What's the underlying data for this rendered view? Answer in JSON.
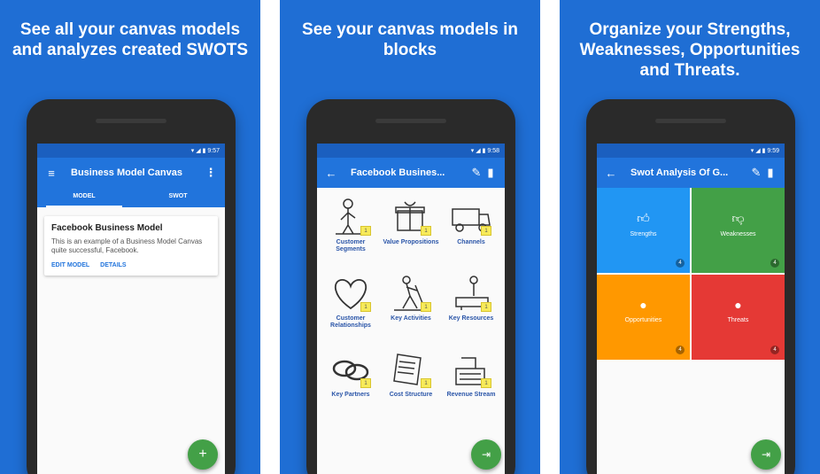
{
  "panels": [
    {
      "headline": "See all your canvas models and analyzes created SWOTS",
      "status_time": "9:57",
      "appbar_title": "Business Model Canvas",
      "tabs": [
        "MODEL",
        "SWOT"
      ],
      "card": {
        "title": "Facebook Business Model",
        "description": "This is an example of a Business Model Canvas quite successful, Facebook.",
        "actions": [
          "EDIT MODEL",
          "DETAILS"
        ]
      },
      "fab_icon": "+"
    },
    {
      "headline": "See your canvas models in blocks",
      "status_time": "9:58",
      "appbar_title": "Facebook Busines...",
      "blocks": [
        {
          "label": "Customer Segments",
          "count": "1"
        },
        {
          "label": "Value Propositions",
          "count": "1"
        },
        {
          "label": "Channels",
          "count": "1"
        },
        {
          "label": "Customer Relationships",
          "count": "1"
        },
        {
          "label": "Key Activities",
          "count": "1"
        },
        {
          "label": "Key Resources",
          "count": "1"
        },
        {
          "label": "Key Partners",
          "count": "1"
        },
        {
          "label": "Cost Structure",
          "count": "1"
        },
        {
          "label": "Revenue Stream",
          "count": "1"
        }
      ]
    },
    {
      "headline": "Organize your Strengths, Weaknesses, Opportunities and Threats.",
      "status_time": "9:59",
      "appbar_title": "Swot Analysis Of G...",
      "swot": [
        {
          "label": "Strengths",
          "color": "#2196f3",
          "icon": "thumbs-up-icon",
          "count": "4"
        },
        {
          "label": "Weaknesses",
          "color": "#43a047",
          "icon": "thumbs-down-icon",
          "count": "4"
        },
        {
          "label": "Opportunities",
          "color": "#ff9800",
          "icon": "lightbulb-icon",
          "count": "4"
        },
        {
          "label": "Threats",
          "color": "#e53935",
          "icon": "bomb-icon",
          "count": "4"
        }
      ]
    }
  ]
}
